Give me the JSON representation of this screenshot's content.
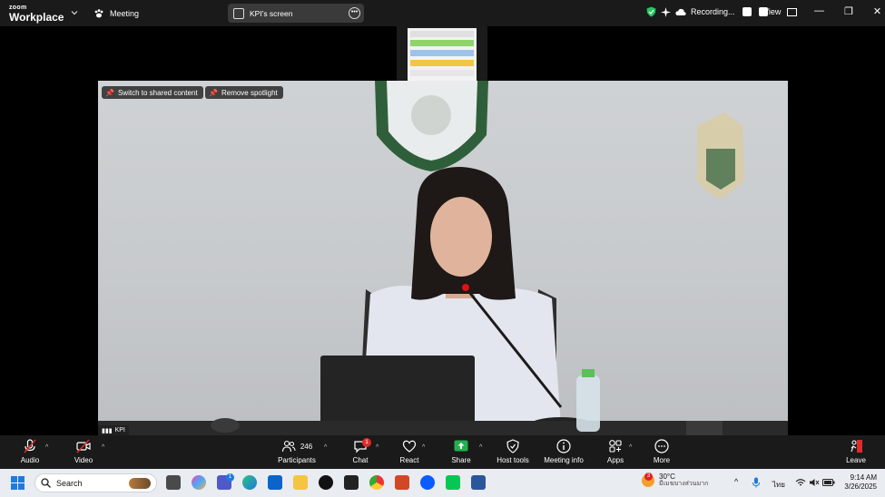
{
  "titlebar": {
    "logo_line1": "zoom",
    "logo_line2": "Workplace",
    "meeting_label": "Meeting",
    "share_label": "KPI's screen",
    "recording_label": "Recording...",
    "view_label": "View",
    "win_minimize": "—",
    "win_restore": "❐",
    "win_close": "✕"
  },
  "video": {
    "switch_label": "Switch to shared content",
    "spotlight_label": "Remove spotlight",
    "participant_name": "KPI"
  },
  "toolbar": {
    "audio": "Audio",
    "video": "Video",
    "participants": "Participants",
    "participant_count": "246",
    "chat": "Chat",
    "chat_badge": "1",
    "react": "React",
    "share": "Share",
    "host_tools": "Host tools",
    "meeting_info": "Meeting info",
    "apps": "Apps",
    "more": "More",
    "leave": "Leave"
  },
  "taskbar": {
    "search_placeholder": "Search",
    "weather_badge": "3",
    "temperature": "30°C",
    "weather_desc": "มีเมฆบางส่วนมาก",
    "language": "ไทย",
    "time": "9:14 AM",
    "date": "3/26/2025",
    "teams_badge": "1"
  },
  "colors": {
    "toolbar_bg": "#1a1a1a",
    "share_green": "#22b14c",
    "badge_red": "#e02b2b",
    "shield_green": "#22c55e"
  }
}
